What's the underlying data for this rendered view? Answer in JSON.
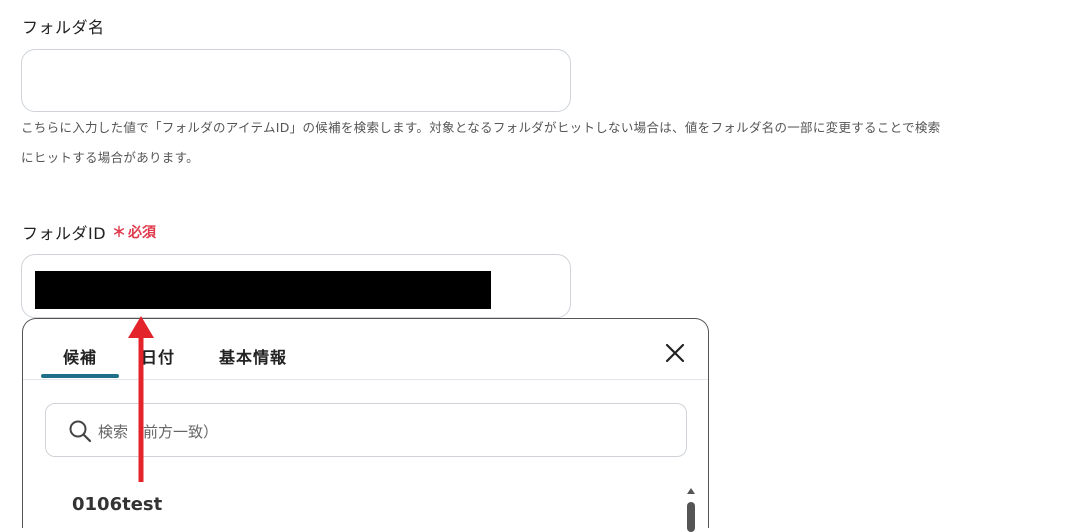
{
  "folder_name": {
    "label": "フォルダ名",
    "value": "",
    "help_line1": "こちらに入力した値で「フォルダのアイテムID」の候補を検索します。対象となるフォルダがヒットしない場合は、値をフォルダ名の一部に変更することで検索",
    "help_line2": "にヒットする場合があります。"
  },
  "folder_id": {
    "label": "フォルダID",
    "required_mark": "＊",
    "required_text": "必須"
  },
  "dropdown": {
    "tabs": [
      {
        "label": "候補"
      },
      {
        "label": "日付"
      },
      {
        "label": "基本情報"
      }
    ],
    "active_tab": "候補",
    "search_placeholder": "検索（前方一致）",
    "items": [
      {
        "label": "0106test"
      }
    ]
  },
  "colors": {
    "required": "#e0394c",
    "tab_indicator": "#1f6f8b",
    "arrow": "#e3242b"
  }
}
